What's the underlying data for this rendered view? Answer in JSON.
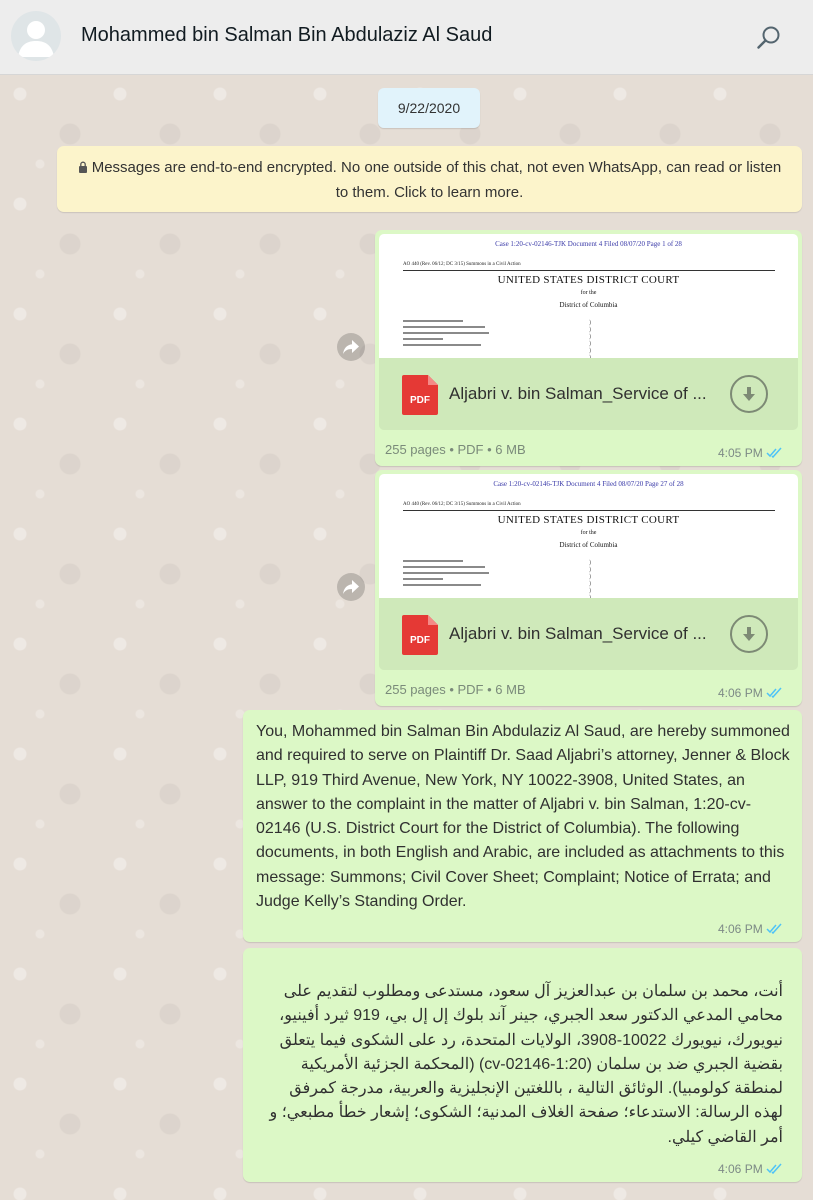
{
  "header": {
    "contact_name": "Mohammed bin Salman Bin Abdulaziz Al Saud",
    "avatar_icon": "default-user-avatar-icon",
    "search_icon": "search-icon"
  },
  "chat": {
    "date_chip": "9/22/2020",
    "encryption_notice": "Messages are end-to-end encrypted. No one outside of this chat, not even WhatsApp, can read or listen to them. Click to learn more.",
    "messages": [
      {
        "type": "document",
        "preview": {
          "header": "Case 1:20-cv-02146-TJK   Document 4   Filed 08/07/20   Page 1 of 28",
          "form": "AO 440 (Rev. 06/12; DC 3/15) Summons in a Civil Action",
          "court": "UNITED STATES DISTRICT COURT",
          "for_the": "for the",
          "district": "District of Columbia"
        },
        "file_icon": "pdf-icon",
        "file_label": "PDF",
        "file_name": "Aljabri v. bin Salman_Service of ...",
        "meta": "255 pages • PDF • 6 MB",
        "time": "4:05 PM"
      },
      {
        "type": "document",
        "preview": {
          "header": "Case 1:20-cv-02146-TJK   Document 4   Filed 08/07/20   Page 27 of 28",
          "form": "AO 440 (Rev. 06/12; DC 3/15) Summons in a Civil Action",
          "court": "UNITED STATES DISTRICT COURT",
          "for_the": "for the",
          "district": "District of Columbia"
        },
        "file_icon": "pdf-icon",
        "file_label": "PDF",
        "file_name": "Aljabri v. bin Salman_Service of ...",
        "meta": "255 pages • PDF • 6 MB",
        "time": "4:06 PM"
      },
      {
        "type": "text",
        "text": "You, Mohammed bin Salman Bin Abdulaziz Al Saud, are hereby summoned and required to serve on Plaintiff Dr. Saad Aljabri’s attorney, Jenner & Block LLP, 919 Third Avenue, New York, NY 10022-3908, United States, an answer to the complaint in the matter of Aljabri v. bin Salman, 1:20-cv-02146 (U.S. District Court for the District of Columbia). The following documents, in both English and Arabic, are included as attachments to this message: Summons; Civil Cover Sheet; Complaint; Notice of Errata; and Judge Kelly’s Standing Order.",
        "time": "4:06 PM"
      },
      {
        "type": "text",
        "text": "أنت، محمد بن سلمان بن عبدالعزيز آل سعود، مستدعى ومطلوب لتقديم على محامي المدعي الدكتور سعد الجبري، جينر آند بلوك إل إل بي، 919 ثيرد أفينيو، نيويورك، نيويورك 10022-3908، الولايات المتحدة، رد على الشكوى فيما يتعلق بقضية الجبري ضد بن سلمان (1:20-cv-02146) (المحكمة الجزئية الأمريكية لمنطقة كولومبيا). الوثائق التالية ، باللغتين الإنجليزية والعربية، مدرجة كمرفق لهذه الرسالة: الاستدعاء؛ صفحة الغلاف المدنية؛ الشكوى؛ إشعار خطأ مطبعي؛ و أمر القاضي كيلي.",
        "time": "4:06 PM"
      }
    ]
  },
  "colors": {
    "outgoing_bubble": "#dcf8c6",
    "file_row": "#cfe9ba",
    "read_ticks": "#4fc3f7",
    "encryption_banner": "#fcf4cb",
    "date_chip": "#e1f3fb",
    "pdf_red": "#e53935"
  }
}
